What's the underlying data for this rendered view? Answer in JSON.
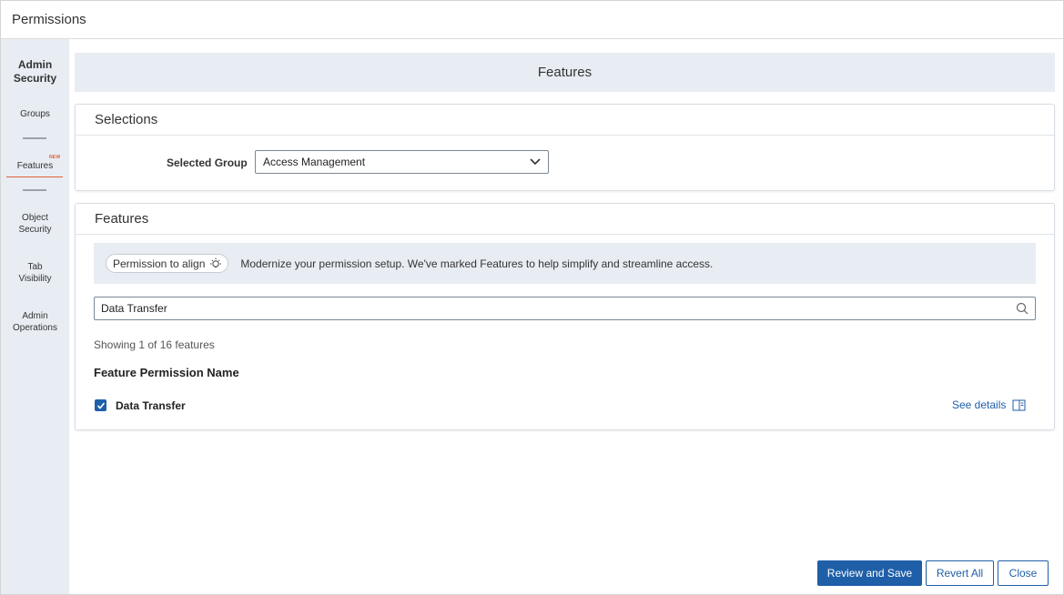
{
  "window": {
    "title": "Permissions"
  },
  "sidebar": {
    "heading": "Admin Security",
    "items": [
      {
        "label": "Groups"
      },
      {
        "label": "Features",
        "badge": "NEW",
        "active": true
      },
      {
        "label": "Object Security"
      },
      {
        "label": "Tab Visibility"
      },
      {
        "label": "Admin Operations"
      }
    ]
  },
  "page": {
    "title": "Features"
  },
  "selections": {
    "title": "Selections",
    "group_label": "Selected Group",
    "group_value": "Access Management"
  },
  "features": {
    "title": "Features",
    "pill_label": "Permission to align",
    "info_text": "Modernize your permission setup. We've marked Features to help simplify and streamline access.",
    "search_value": "Data Transfer",
    "showing_text": "Showing 1 of 16 features",
    "column_header": "Feature Permission Name",
    "rows": [
      {
        "name": "Data Transfer",
        "checked": true,
        "details_label": "See details"
      }
    ]
  },
  "footer": {
    "review_label": "Review and Save",
    "revert_label": "Revert All",
    "close_label": "Close"
  },
  "colors": {
    "accent": "#1f5fa8",
    "active_underline": "#e0623a",
    "sidebar_bg": "#e8edf3"
  }
}
